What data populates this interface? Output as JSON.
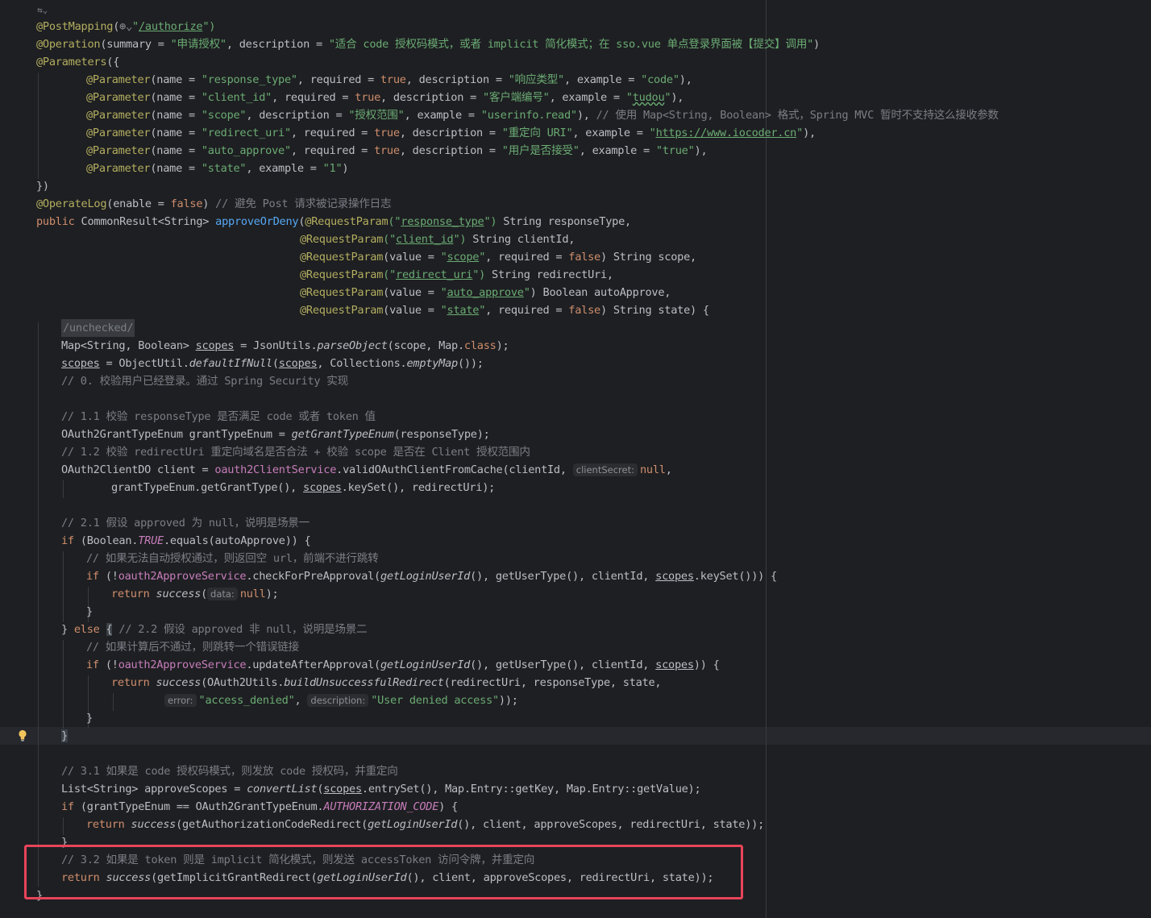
{
  "colors": {
    "background": "#1e1f22",
    "annotation": "#b3ae60",
    "string": "#6aab73",
    "keyword": "#cf8e6d",
    "comment": "#7a7e85",
    "field": "#c77dbb",
    "method": "#56a8f5",
    "highlight_box": "#e8445a"
  },
  "editor": {
    "fold_marker": "⇆⌄",
    "lines": {
      "l01": {
        "a": "@PostMapping",
        "b": "(",
        "c": "\"",
        "d": "/authorize",
        "e": "\")"
      },
      "l02": {
        "a": "@Operation",
        "b": "(summary = ",
        "c": "\"申请授权\"",
        "d": ", description = ",
        "e": "\"适合 code 授权码模式，或者 implicit 简化模式；在 sso.vue 单点登录界面被【提交】调用\"",
        "f": ")"
      },
      "l03": {
        "a": "@Parameters",
        "b": "({"
      },
      "l04": {
        "a": "@Parameter",
        "b": "(name = ",
        "c": "\"response_type\"",
        "d": ", required = ",
        "e": "true",
        "f": ", description = ",
        "g": "\"响应类型\"",
        "h": ", example = ",
        "i": "\"code\"",
        "j": "),"
      },
      "l05": {
        "a": "@Parameter",
        "b": "(name = ",
        "c": "\"client_id\"",
        "d": ", required = ",
        "e": "true",
        "f": ", description = ",
        "g": "\"客户端编号\"",
        "h": ", example = ",
        "i": "\"",
        "j": "tudou",
        "k": "\"",
        "l": "),"
      },
      "l06": {
        "a": "@Parameter",
        "b": "(name = ",
        "c": "\"scope\"",
        "d": ", description = ",
        "e": "\"授权范围\"",
        "f": ", example = ",
        "g": "\"userinfo.read\"",
        "h": "), ",
        "i": "// 使用 Map<String, Boolean> 格式，Spring MVC 暂时不支持这么接收参数"
      },
      "l07": {
        "a": "@Parameter",
        "b": "(name = ",
        "c": "\"redirect_uri\"",
        "d": ", required = ",
        "e": "true",
        "f": ", description = ",
        "g": "\"重定向 URI\"",
        "h": ", example = ",
        "i": "\"",
        "j": "https://www.iocoder.cn",
        "k": "\"",
        "l": "),"
      },
      "l08": {
        "a": "@Parameter",
        "b": "(name = ",
        "c": "\"auto_approve\"",
        "d": ", required = ",
        "e": "true",
        "f": ", description = ",
        "g": "\"用户是否接受\"",
        "h": ", example = ",
        "i": "\"true\"",
        "j": "),"
      },
      "l09": {
        "a": "@Parameter",
        "b": "(name = ",
        "c": "\"state\"",
        "d": ", example = ",
        "e": "\"1\"",
        "f": ")"
      },
      "l10": {
        "a": "})"
      },
      "l11": {
        "a": "@OperateLog",
        "b": "(enable = ",
        "c": "false",
        "d": ") ",
        "e": "// 避免 Post 请求被记录操作日志"
      },
      "l12": {
        "a": "public ",
        "b": "CommonResult<String> ",
        "c": "approveOrDeny",
        "d": "(",
        "e": "@RequestParam",
        "f": "(\"",
        "g": "response_type",
        "h": "\")",
        "i": " String responseType,"
      },
      "l13": {
        "a": "@RequestParam",
        "b": "(\"",
        "c": "client_id",
        "d": "\")",
        "e": " String clientId,"
      },
      "l14": {
        "a": "@RequestParam",
        "b": "(value = ",
        "c": "\"",
        "d": "scope",
        "e": "\"",
        "f": ", required = ",
        "g": "false",
        "h": ") String scope,"
      },
      "l15": {
        "a": "@RequestParam",
        "b": "(\"",
        "c": "redirect_uri",
        "d": "\")",
        "e": " String redirectUri,"
      },
      "l16": {
        "a": "@RequestParam",
        "b": "(value = ",
        "c": "\"",
        "d": "auto_approve",
        "e": "\"",
        "f": ") Boolean autoApprove,"
      },
      "l17": {
        "a": "@RequestParam",
        "b": "(value = ",
        "c": "\"",
        "d": "state",
        "e": "\"",
        "f": ", required = ",
        "g": "false",
        "h": ") String state) {"
      },
      "l18": {
        "a": "/unchecked/"
      },
      "l19": {
        "a": "Map<String, Boolean> ",
        "b": "scopes",
        "c": " = JsonUtils.",
        "d": "parseObject",
        "e": "(scope, Map.",
        "f": "class",
        "g": ");"
      },
      "l20": {
        "a": "scopes",
        "b": " = ObjectUtil.",
        "c": "defaultIfNull",
        "d": "(",
        "e": "scopes",
        "f": ", Collections.",
        "g": "emptyMap",
        "h": "());"
      },
      "l21": {
        "a": "// 0. 校验用户已经登录。通过 Spring Security 实现"
      },
      "l22": {
        "a": "// 1.1 校验 responseType 是否满足 code 或者 token 值"
      },
      "l23": {
        "a": "OAuth2GrantTypeEnum grantTypeEnum = ",
        "b": "getGrantTypeEnum",
        "c": "(responseType);"
      },
      "l24": {
        "a": "// 1.2 校验 redirectUri 重定向域名是否合法 + 校验 scope 是否在 Client 授权范围内"
      },
      "l25": {
        "a": "OAuth2ClientDO client = ",
        "b": "oauth2ClientService",
        "c": ".validOAuthClientFromCache(clientId, ",
        "d": "clientSecret:",
        "e": "null",
        "f": ","
      },
      "l26": {
        "a": "grantTypeEnum.getGrantType(), ",
        "b": "scopes",
        "c": ".keySet(), redirectUri);"
      },
      "l27": {
        "a": "// 2.1 假设 approved 为 null，说明是场景一"
      },
      "l28": {
        "a": "if ",
        "b": "(Boolean.",
        "c": "TRUE",
        "d": ".equals(autoApprove)) {"
      },
      "l29": {
        "a": "// 如果无法自动授权通过，则返回空 url，前端不进行跳转"
      },
      "l30": {
        "a": "if ",
        "b": "(!",
        "c": "oauth2ApproveService",
        "d": ".checkForPreApproval(",
        "e": "getLoginUserId",
        "f": "(), getUserType(), clientId, ",
        "g": "scopes",
        "h": ".keySet())) {"
      },
      "l31": {
        "a": "return ",
        "b": "success",
        "c": "(",
        "d": "data:",
        "e": "null",
        "f": ");"
      },
      "l32": {
        "a": "}"
      },
      "l33": {
        "a": "} ",
        "b": "else ",
        "c": "{",
        "d": " // 2.2 假设 approved 非 null，说明是场景二"
      },
      "l34": {
        "a": "// 如果计算后不通过，则跳转一个错误链接"
      },
      "l35": {
        "a": "if ",
        "b": "(!",
        "c": "oauth2ApproveService",
        "d": ".updateAfterApproval(",
        "e": "getLoginUserId",
        "f": "(), getUserType(), clientId, ",
        "g": "scopes",
        "h": ")) {"
      },
      "l36": {
        "a": "return ",
        "b": "success",
        "c": "(OAuth2Utils.",
        "d": "buildUnsuccessfulRedirect",
        "e": "(redirectUri, responseType, state,"
      },
      "l37": {
        "a": "error:",
        "b": "\"access_denied\"",
        "c": ", ",
        "d": "description:",
        "e": "\"User denied access\"",
        "f": "));"
      },
      "l38": {
        "a": "}"
      },
      "l39": {
        "a": "}"
      },
      "l40": {
        "a": "// 3.1 如果是 code 授权码模式，则发放 code 授权码，并重定向"
      },
      "l41": {
        "a": "List<String> approveScopes = ",
        "b": "convertList",
        "c": "(",
        "d": "scopes",
        "e": ".entrySet(), Map.Entry::getKey, Map.Entry::getValue);"
      },
      "l42": {
        "a": "if ",
        "b": "(grantTypeEnum == OAuth2GrantTypeEnum.",
        "c": "AUTHORIZATION_CODE",
        "d": ") {"
      },
      "l43": {
        "a": "return ",
        "b": "success",
        "c": "(getAuthorizationCodeRedirect(",
        "d": "getLoginUserId",
        "e": "(), client, approveScopes, redirectUri, state));"
      },
      "l44": {
        "a": "}"
      },
      "l45": {
        "a": "// 3.2 如果是 token 则是 implicit 简化模式，则发送 accessToken 访问令牌，并重定向"
      },
      "l46": {
        "a": "return ",
        "b": "success",
        "c": "(getImplicitGrantRedirect(",
        "d": "getLoginUserId",
        "e": "(), client, approveScopes, redirectUri, state));"
      },
      "l47": {
        "a": "}"
      }
    }
  }
}
